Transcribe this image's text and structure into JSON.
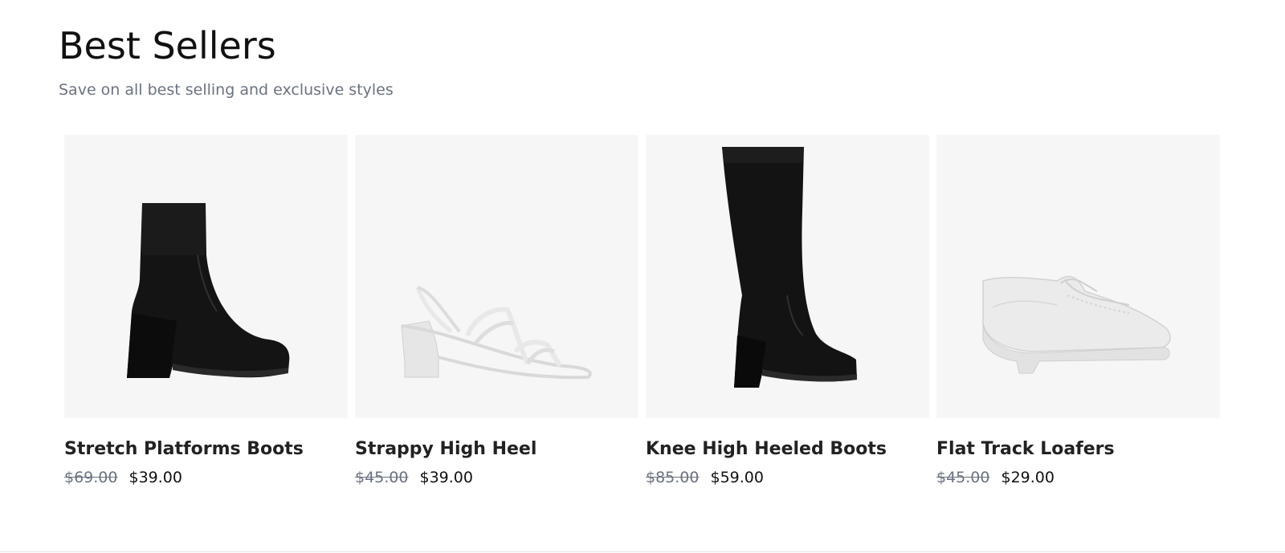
{
  "section": {
    "title": "Best Sellers",
    "subtitle": "Save on all best selling and exclusive styles"
  },
  "products": [
    {
      "name": "Stretch Platforms Boots",
      "original_price": "$69.00",
      "sale_price": "$39.00",
      "image_icon": "black-ankle-boot",
      "color": "#111111"
    },
    {
      "name": "Strappy High Heel",
      "original_price": "$45.00",
      "sale_price": "$39.00",
      "image_icon": "white-strappy-sandal",
      "color": "#ececec"
    },
    {
      "name": "Knee High Heeled Boots",
      "original_price": "$85.00",
      "sale_price": "$59.00",
      "image_icon": "black-knee-high-boot",
      "color": "#111111"
    },
    {
      "name": "Flat Track Loafers",
      "original_price": "$45.00",
      "sale_price": "$29.00",
      "image_icon": "white-chunky-loafer",
      "color": "#ececec"
    }
  ],
  "colors": {
    "image_background": "#f6f6f6",
    "muted_text": "#6b7280"
  }
}
